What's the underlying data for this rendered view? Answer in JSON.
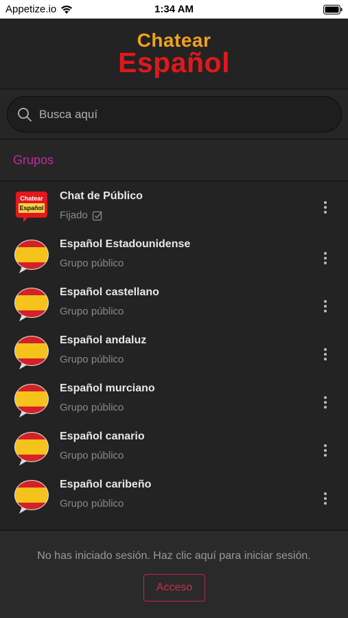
{
  "status_bar": {
    "carrier": "Appetize.io",
    "time": "1:34 AM"
  },
  "header": {
    "logo_line1": "Chatear",
    "logo_line2": "Español"
  },
  "search": {
    "placeholder": "Busca aquí"
  },
  "section": {
    "title": "Grupos"
  },
  "groups": [
    {
      "name": "Chat de Público",
      "subtitle": "Fijado",
      "avatar": "chatear-espanol-logo"
    },
    {
      "name": "Español Estadounidense",
      "subtitle": "Grupo público",
      "avatar": "spain-flag"
    },
    {
      "name": "Español castellano",
      "subtitle": "Grupo público",
      "avatar": "spain-flag"
    },
    {
      "name": "Español andaluz",
      "subtitle": "Grupo público",
      "avatar": "spain-flag"
    },
    {
      "name": "Español murciano",
      "subtitle": "Grupo público",
      "avatar": "spain-flag"
    },
    {
      "name": "Español canario",
      "subtitle": "Grupo público",
      "avatar": "spain-flag"
    },
    {
      "name": "Español caribeño",
      "subtitle": "Grupo público",
      "avatar": "spain-flag"
    }
  ],
  "footer": {
    "message": "No has iniciado sesión. Haz clic aquí para iniciar sesión.",
    "login_label": "Acceso"
  },
  "colors": {
    "accent": "#c12b9c",
    "login": "#d02a52",
    "logo_top": "#f0a21e",
    "logo_bottom": "#e1181c"
  }
}
